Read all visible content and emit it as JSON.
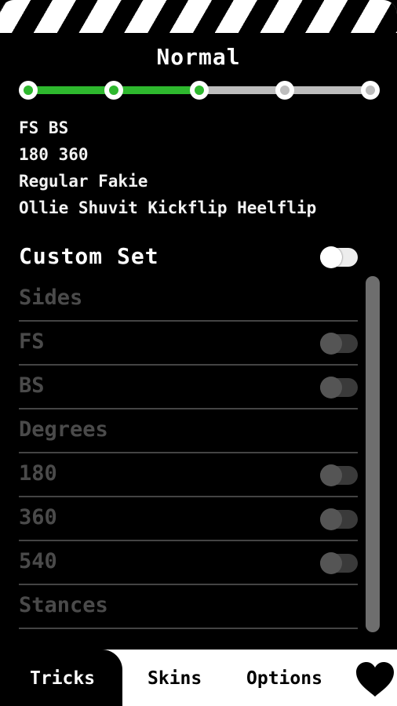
{
  "header": {
    "difficulty": "Normal",
    "difficulty_levels": 5,
    "difficulty_index": 2
  },
  "summary": {
    "lines": [
      "FS BS",
      "180 360",
      "Regular Fakie",
      "Ollie Shuvit Kickflip Heelflip"
    ]
  },
  "custom_set": {
    "label": "Custom Set",
    "enabled": false
  },
  "options": [
    {
      "label": "Sides",
      "type": "header"
    },
    {
      "label": "FS",
      "type": "toggle",
      "on": false
    },
    {
      "label": "BS",
      "type": "toggle",
      "on": false
    },
    {
      "label": "Degrees",
      "type": "header"
    },
    {
      "label": "180",
      "type": "toggle",
      "on": false
    },
    {
      "label": "360",
      "type": "toggle",
      "on": false
    },
    {
      "label": "540",
      "type": "toggle",
      "on": false
    },
    {
      "label": "Stances",
      "type": "header"
    }
  ],
  "tabs": {
    "tricks": "Tricks",
    "skins": "Skins",
    "options": "Options",
    "favorite_icon": "heart-icon"
  },
  "colors": {
    "accent": "#2eb82e",
    "background": "#000000",
    "disabled_text": "#4a4a4a"
  }
}
